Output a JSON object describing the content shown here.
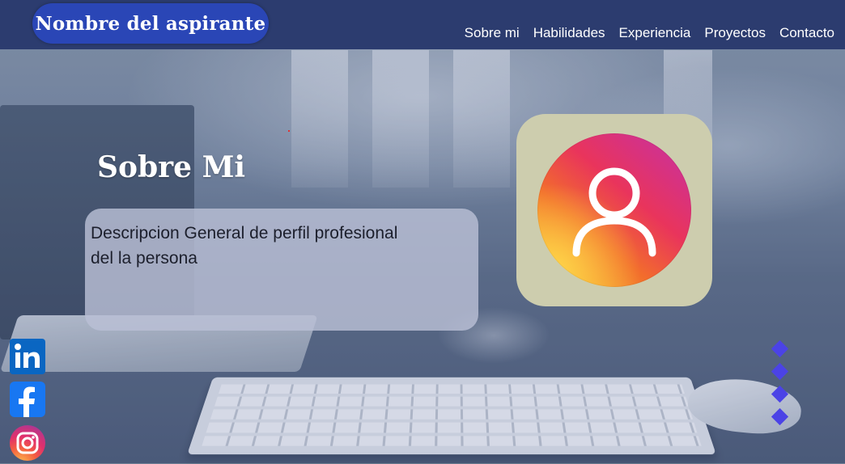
{
  "header": {
    "brand": "Nombre del aspirante",
    "nav": [
      {
        "label": "Sobre mi"
      },
      {
        "label": "Habilidades"
      },
      {
        "label": "Experiencia"
      },
      {
        "label": "Proyectos"
      },
      {
        "label": "Contacto"
      }
    ]
  },
  "about": {
    "title": "Sobre Mi",
    "description": "Descripcion General de perfil profesional del la persona"
  },
  "avatar": {
    "icon": "user-icon"
  },
  "social": [
    {
      "icon": "linkedin-icon"
    },
    {
      "icon": "facebook-icon"
    },
    {
      "icon": "instagram-icon"
    }
  ],
  "carousel": {
    "dot_count": 4,
    "accent": "#4b43e6"
  },
  "colors": {
    "header": "#2c3c6f",
    "brand_pill": "#2a46b6",
    "avatar_card": "#cdcdae"
  }
}
